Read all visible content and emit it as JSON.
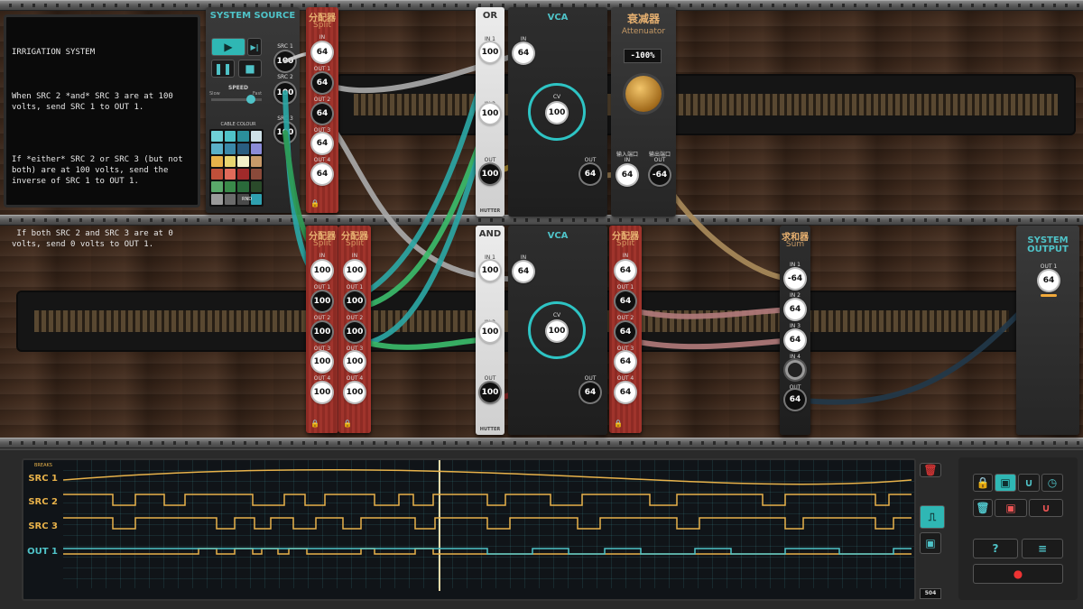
{
  "instructions": {
    "title": "IRRIGATION SYSTEM",
    "para1": "When SRC 2 *and* SRC 3 are at 100 volts, send SRC 1 to OUT 1.",
    "para2": "If *either* SRC 2 or SRC 3 (but not both) are at 100 volts, send the inverse of SRC 1 to OUT 1.",
    "para3": " If both SRC 2 and SRC 3 are at 0 volts, send 0 volts to OUT 1."
  },
  "source": {
    "title": "SYSTEM SOURCE",
    "speed_label": "SPEED",
    "slow_label": "Slow",
    "fast_label": "Fast",
    "cable_label": "CABLE COLOUR",
    "rnd_label": "RND",
    "src1": "SRC 1",
    "src2": "SRC 2",
    "src3": "SRC 3",
    "v1": "100",
    "v2": "100",
    "v3": "100"
  },
  "split": {
    "title": "分配器",
    "sub": "Split",
    "in": "IN",
    "out1": "OUT 1",
    "out2": "OUT 2",
    "out3": "OUT 3",
    "out4": "OUT 4"
  },
  "split1": {
    "in": "64",
    "o1": "64",
    "o2": "64",
    "o3": "64",
    "o4": "64"
  },
  "split2": {
    "in": "100",
    "o1": "100",
    "o2": "100",
    "o3": "100",
    "o4": "100"
  },
  "split3": {
    "in": "100",
    "o1": "100",
    "o2": "100",
    "o3": "100",
    "o4": "100"
  },
  "split4": {
    "in": "64",
    "o1": "64",
    "o2": "64",
    "o3": "64",
    "o4": "64"
  },
  "or": {
    "title": "OR",
    "in1": "IN 1",
    "in2": "IN 2",
    "out": "OUT",
    "v_in1": "100",
    "v_in2": "100",
    "v_out": "100",
    "brand": "HUTTER"
  },
  "and": {
    "title": "AND",
    "in1": "IN 1",
    "in2": "IN 2",
    "out": "OUT",
    "v_in1": "100",
    "v_in2": "100",
    "v_out": "100",
    "brand": "HUTTER"
  },
  "vca1": {
    "title": "VCA",
    "in": "IN",
    "cv": "CV",
    "out": "OUT",
    "v_in": "64",
    "v_cv": "100",
    "v_out": "64"
  },
  "vca2": {
    "title": "VCA",
    "in": "IN",
    "cv": "CV",
    "out": "OUT",
    "v_in": "64",
    "v_cv": "100",
    "v_out": "64"
  },
  "atten": {
    "title": "衰减器",
    "sub": "Attenuator",
    "display": "-100%",
    "in_label": "输入端口",
    "in": "IN",
    "out_label": "输出端口",
    "out": "OUT",
    "v_in": "64",
    "v_out": "-64"
  },
  "sum": {
    "title": "求和器",
    "sub": "Sum",
    "in1": "IN 1",
    "in2": "IN 2",
    "in3": "IN 3",
    "in4": "IN 4",
    "out": "OUT",
    "v_in1": "-64",
    "v_in2": "64",
    "v_in3": "64",
    "v_out": "64"
  },
  "sysout": {
    "title": "SYSTEM OUTPUT",
    "out1": "OUT 1",
    "v_out1": "64"
  },
  "scope": {
    "breaks": "BREAKS",
    "tracks": [
      "SRC 1",
      "SRC 2",
      "SRC 3",
      "OUT 1"
    ],
    "counter": "504"
  },
  "colors": {
    "teal": "#4fc3c8",
    "yellow": "#e8b24a",
    "red_panel": "#9a3029"
  }
}
